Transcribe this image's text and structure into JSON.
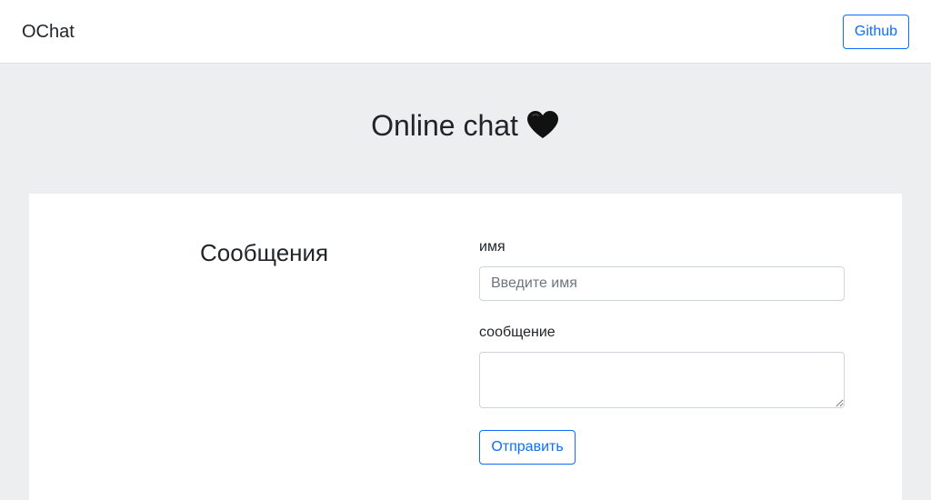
{
  "navbar": {
    "brand": "OChat",
    "github_label": "Github"
  },
  "hero": {
    "title": "Online chat",
    "icon": "black-heart-icon"
  },
  "messages": {
    "heading": "Сообщения"
  },
  "form": {
    "name_label": "имя",
    "name_placeholder": "Введите имя",
    "name_value": "",
    "message_label": "сообщение",
    "message_value": "",
    "submit_label": "Отправить"
  },
  "colors": {
    "accent": "#0d6efd",
    "page_background": "#eceef0",
    "card_background": "#ffffff",
    "heart": "#111111"
  }
}
